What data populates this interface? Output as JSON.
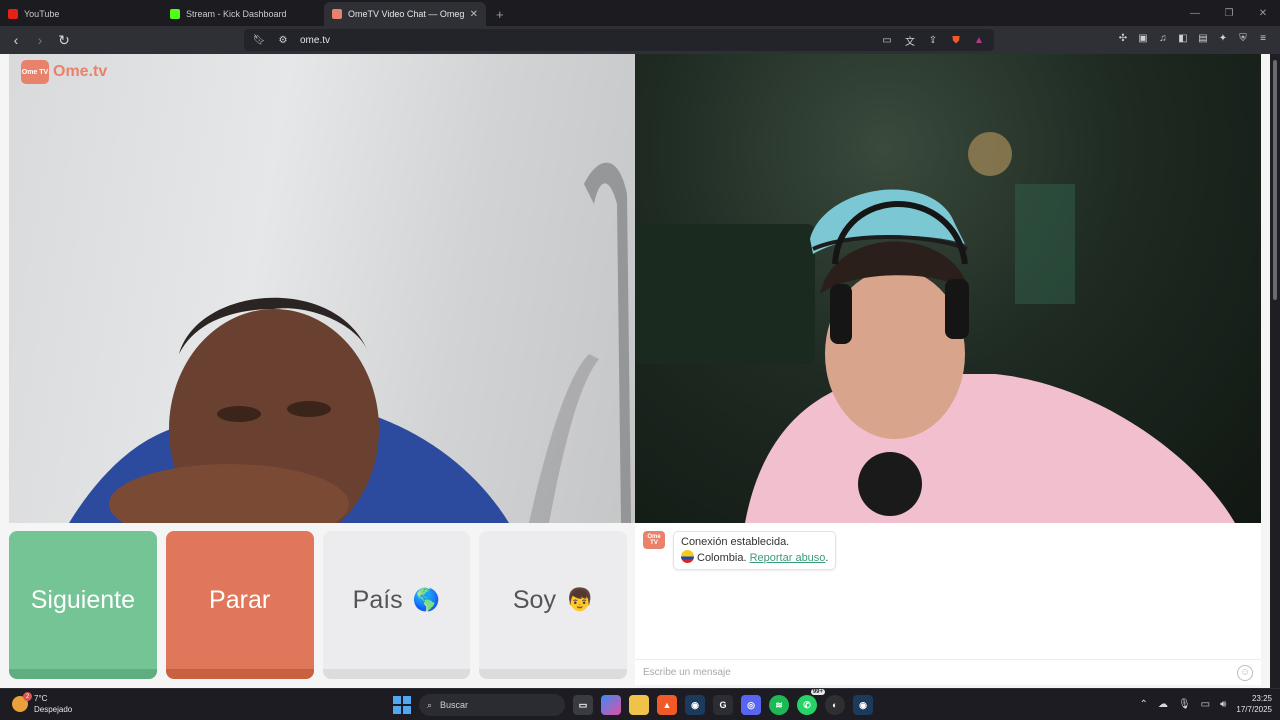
{
  "browser": {
    "tabs": [
      {
        "title": "YouTube",
        "favicon_color": "#e62117"
      },
      {
        "title": "Stream - Kick Dashboard",
        "favicon_color": "#53fc18"
      },
      {
        "title": "OmeTV Video Chat — Omegl",
        "favicon_color": "#e9826a",
        "active": true
      }
    ],
    "new_tab": "+",
    "url": "ome.tv",
    "shields_badge": "2"
  },
  "logo": {
    "tv_label": "Ome TV",
    "text": "Ome.tv"
  },
  "actions": {
    "next_label": "Siguiente",
    "stop_label": "Parar",
    "country_label": "País",
    "country_emoji": "🌎",
    "gender_label": "Soy",
    "gender_emoji": "👦"
  },
  "chat": {
    "avatar_label": "Ome TV",
    "status": "Conexión establecida.",
    "country": "Colombia.",
    "report_label": "Reportar abuso",
    "report_suffix": ".",
    "input_placeholder": "Escribe un mensaje"
  },
  "taskbar": {
    "weather_temp": "7°C",
    "weather_desc": "Despejado",
    "weather_badge": "2",
    "search_placeholder": "Buscar",
    "whatsapp_count": "99+",
    "time": "23:25",
    "date": "17/7/2025"
  },
  "colors": {
    "next": "#74c495",
    "stop": "#e0765a",
    "brand": "#e9826a",
    "link": "#3e9b77"
  }
}
